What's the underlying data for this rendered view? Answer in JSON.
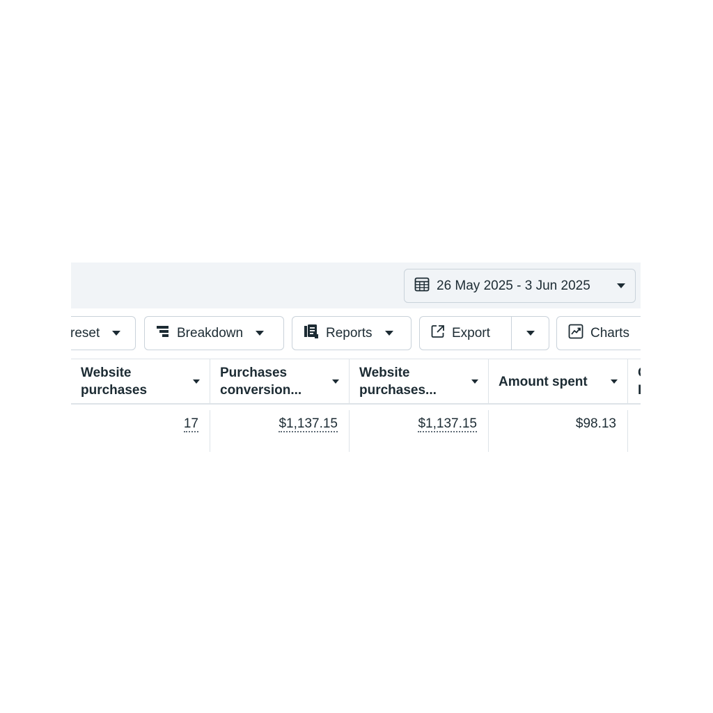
{
  "date_range": {
    "label": "26 May 2025 - 3 Jun 2025",
    "icon": "calendar-icon"
  },
  "toolbar": {
    "preset_label": "reset",
    "breakdown_label": "Breakdown",
    "reports_label": "Reports",
    "export_label": "Export",
    "charts_label": "Charts"
  },
  "table": {
    "columns": [
      {
        "label": "Website\npurchases"
      },
      {
        "label": "Purchases\nconversion..."
      },
      {
        "label": "Website\npurchases..."
      },
      {
        "label": "Amount spent"
      },
      {
        "label": "C\nI"
      }
    ],
    "row": {
      "website_purchases": "17",
      "purchases_conversion_value": "$1,137.15",
      "website_purchases_value": "$1,137.15",
      "amount_spent": "$98.13"
    }
  },
  "colors": {
    "text": "#1c2b33",
    "border": "#c9d2da",
    "band": "#f1f4f7"
  }
}
